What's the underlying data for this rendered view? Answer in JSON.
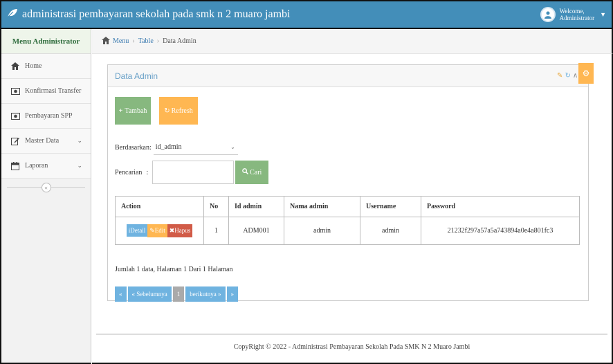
{
  "navbar": {
    "title": "administrasi pembayaran sekolah pada smk n 2 muaro jambi",
    "welcome": "Welcome,",
    "user": "Administrator"
  },
  "sidebar": {
    "header": "Menu Administrator",
    "items": [
      {
        "label": "Home",
        "icon": "home-icon"
      },
      {
        "label": "Konfirmasi Transfer",
        "icon": "money-icon"
      },
      {
        "label": "Pembayaran SPP",
        "icon": "money-icon"
      },
      {
        "label": "Master Data",
        "icon": "edit-icon",
        "expandable": true
      },
      {
        "label": "Laporan",
        "icon": "calendar-icon",
        "expandable": true
      }
    ]
  },
  "breadcrumb": {
    "items": [
      "Menu",
      "Table",
      "Data Admin"
    ]
  },
  "widget": {
    "title": "Data Admin",
    "tambah_label": "Tambah",
    "refresh_label": "Refresh",
    "filter_label": "Berdasarkan:",
    "filter_value": "id_admin",
    "search_label": "Pencarian",
    "search_value": "",
    "cari_label": "Cari"
  },
  "table": {
    "headers": [
      "Action",
      "No",
      "Id admin",
      "Nama admin",
      "Username",
      "Password"
    ],
    "actions": {
      "detail": "Detail",
      "edit": "Edit",
      "hapus": "Hapus"
    },
    "rows": [
      {
        "no": "1",
        "id_admin": "ADM001",
        "nama_admin": "admin",
        "username": "admin",
        "password": "21232f297a57a5a743894a0e4a801fc3"
      }
    ]
  },
  "summary": "Jumlah 1 data, Halaman 1 Dari 1 Halaman",
  "pagination": {
    "first": "«",
    "prev": "« Sebelumnya",
    "current": "1",
    "next": "berikutnya »",
    "last": "»"
  },
  "footer": "CopyRight © 2022 - Administrasi Pembayaran Sekolah Pada SMK N 2 Muaro Jambi",
  "colors": {
    "navbar": "#438eb9",
    "success": "#87b87f",
    "warning": "#ffb752",
    "info": "#6fb3e0",
    "danger": "#d15b47"
  }
}
